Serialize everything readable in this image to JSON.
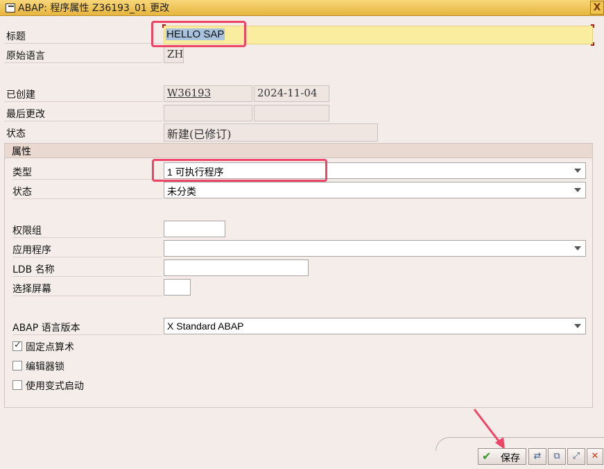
{
  "window": {
    "title": "ABAP: 程序属性 Z36193_01 更改",
    "close_label": "X"
  },
  "header": {
    "title_label": "标题",
    "title_value": "HELLO SAP",
    "language_label": "原始语言",
    "language_value": "ZH",
    "created_label": "已创建",
    "created_by": "W36193",
    "created_date": "2024-11-04",
    "changed_label": "最后更改",
    "changed_by": "",
    "changed_date": "",
    "status_label": "状态",
    "status_value": "新建(已修订)"
  },
  "attributes": {
    "group_title": "属性",
    "type_label": "类型",
    "type_value": "1 可执行程序",
    "status_label": "状态",
    "status_value": "未分类",
    "auth_group_label": "权限组",
    "auth_group_value": "",
    "application_label": "应用程序",
    "application_value": "",
    "ldb_label": "LDB 名称",
    "ldb_value": "",
    "selection_screen_label": "选择屏幕",
    "selection_screen_value": "",
    "abap_version_label": "ABAP 语言版本",
    "abap_version_value": "X Standard ABAP",
    "fixed_point_label": "固定点算术",
    "fixed_point_checked": true,
    "editor_lock_label": "编辑器锁",
    "editor_lock_checked": false,
    "variant_start_label": "使用变式启动",
    "variant_start_checked": false
  },
  "footer": {
    "save_label": "保存"
  },
  "colors": {
    "title_bar": "#e7b53d",
    "required_field": "#fbeda0",
    "annotation": "#ee4466",
    "save_check": "#3a9b2c"
  }
}
